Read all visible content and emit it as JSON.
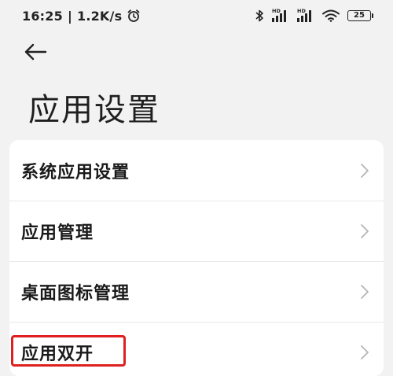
{
  "status_bar": {
    "time": "16:25",
    "separator": "|",
    "network_speed": "1.2K/s",
    "icons": [
      "alarm-icon",
      "bluetooth-icon",
      "signal-hd-1-icon",
      "signal-hd-2-icon",
      "wifi-icon",
      "battery-icon"
    ],
    "hd_label_1": "HD",
    "hd_label_2": "HD",
    "battery_level": "25"
  },
  "header": {
    "back_icon": "arrow-left-icon",
    "title": "应用设置"
  },
  "settings_list": {
    "items": [
      {
        "label": "系统应用设置",
        "icon": "chevron-right-icon"
      },
      {
        "label": "应用管理",
        "icon": "chevron-right-icon"
      },
      {
        "label": "桌面图标管理",
        "icon": "chevron-right-icon"
      },
      {
        "label": "应用双开",
        "icon": "chevron-right-icon"
      }
    ]
  },
  "colors": {
    "background": "#f2f2f2",
    "card": "#ffffff",
    "highlight": "#e02020",
    "chevron": "#b5b5b5"
  }
}
